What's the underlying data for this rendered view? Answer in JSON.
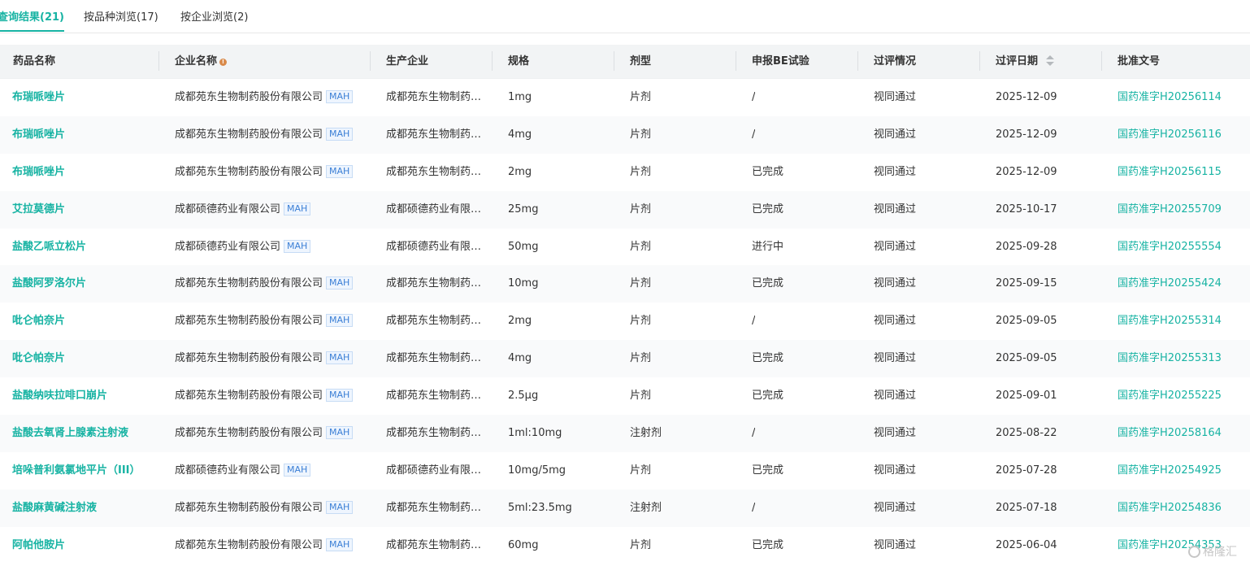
{
  "tabs": [
    {
      "label": "查询结果(21)",
      "active": true
    },
    {
      "label": "按品种浏览(17)",
      "active": false
    },
    {
      "label": "按企业浏览(2)",
      "active": false
    }
  ],
  "columns": [
    "药品名称",
    "企业名称",
    "生产企业",
    "规格",
    "剂型",
    "申报BE试验",
    "过评情况",
    "过评日期",
    "批准文号"
  ],
  "info_icon_glyph": "!",
  "badge_label": "MAH",
  "rows": [
    {
      "drug": "布瑞哌唑片",
      "company": "成都苑东生物制药股份有限公司",
      "producer": "成都苑东生物制药…",
      "spec": "1mg",
      "form": "片剂",
      "be": "/",
      "status": "视同通过",
      "date": "2025-12-09",
      "approval": "国药准字H20256114"
    },
    {
      "drug": "布瑞哌唑片",
      "company": "成都苑东生物制药股份有限公司",
      "producer": "成都苑东生物制药…",
      "spec": "4mg",
      "form": "片剂",
      "be": "/",
      "status": "视同通过",
      "date": "2025-12-09",
      "approval": "国药准字H20256116"
    },
    {
      "drug": "布瑞哌唑片",
      "company": "成都苑东生物制药股份有限公司",
      "producer": "成都苑东生物制药…",
      "spec": "2mg",
      "form": "片剂",
      "be": "已完成",
      "status": "视同通过",
      "date": "2025-12-09",
      "approval": "国药准字H20256115"
    },
    {
      "drug": "艾拉莫德片",
      "company": "成都硕德药业有限公司",
      "producer": "成都硕德药业有限…",
      "spec": "25mg",
      "form": "片剂",
      "be": "已完成",
      "status": "视同通过",
      "date": "2025-10-17",
      "approval": "国药准字H20255709"
    },
    {
      "drug": "盐酸乙哌立松片",
      "company": "成都硕德药业有限公司",
      "producer": "成都硕德药业有限…",
      "spec": "50mg",
      "form": "片剂",
      "be": "进行中",
      "status": "视同通过",
      "date": "2025-09-28",
      "approval": "国药准字H20255554"
    },
    {
      "drug": "盐酸阿罗洛尔片",
      "company": "成都苑东生物制药股份有限公司",
      "producer": "成都苑东生物制药…",
      "spec": "10mg",
      "form": "片剂",
      "be": "已完成",
      "status": "视同通过",
      "date": "2025-09-15",
      "approval": "国药准字H20255424"
    },
    {
      "drug": "吡仑帕奈片",
      "company": "成都苑东生物制药股份有限公司",
      "producer": "成都苑东生物制药…",
      "spec": "2mg",
      "form": "片剂",
      "be": "/",
      "status": "视同通过",
      "date": "2025-09-05",
      "approval": "国药准字H20255314"
    },
    {
      "drug": "吡仑帕奈片",
      "company": "成都苑东生物制药股份有限公司",
      "producer": "成都苑东生物制药…",
      "spec": "4mg",
      "form": "片剂",
      "be": "已完成",
      "status": "视同通过",
      "date": "2025-09-05",
      "approval": "国药准字H20255313"
    },
    {
      "drug": "盐酸纳呋拉啡口崩片",
      "company": "成都苑东生物制药股份有限公司",
      "producer": "成都苑东生物制药…",
      "spec": "2.5μg",
      "form": "片剂",
      "be": "已完成",
      "status": "视同通过",
      "date": "2025-09-01",
      "approval": "国药准字H20255225"
    },
    {
      "drug": "盐酸去氧肾上腺素注射液",
      "company": "成都苑东生物制药股份有限公司",
      "producer": "成都苑东生物制药…",
      "spec": "1ml:10mg",
      "form": "注射剂",
      "be": "/",
      "status": "视同通过",
      "date": "2025-08-22",
      "approval": "国药准字H20258164"
    },
    {
      "drug": "培哚普利氨氯地平片（III）",
      "company": "成都硕德药业有限公司",
      "producer": "成都硕德药业有限…",
      "spec": "10mg/5mg",
      "form": "片剂",
      "be": "已完成",
      "status": "视同通过",
      "date": "2025-07-28",
      "approval": "国药准字H20254925"
    },
    {
      "drug": "盐酸麻黄碱注射液",
      "company": "成都苑东生物制药股份有限公司",
      "producer": "成都苑东生物制药…",
      "spec": "5ml:23.5mg",
      "form": "注射剂",
      "be": "/",
      "status": "视同通过",
      "date": "2025-07-18",
      "approval": "国药准字H20254836"
    },
    {
      "drug": "阿帕他胺片",
      "company": "成都苑东生物制药股份有限公司",
      "producer": "成都苑东生物制药…",
      "spec": "60mg",
      "form": "片剂",
      "be": "已完成",
      "status": "视同通过",
      "date": "2025-06-04",
      "approval": "国药准字H20254353"
    }
  ],
  "watermark": "格隆汇"
}
